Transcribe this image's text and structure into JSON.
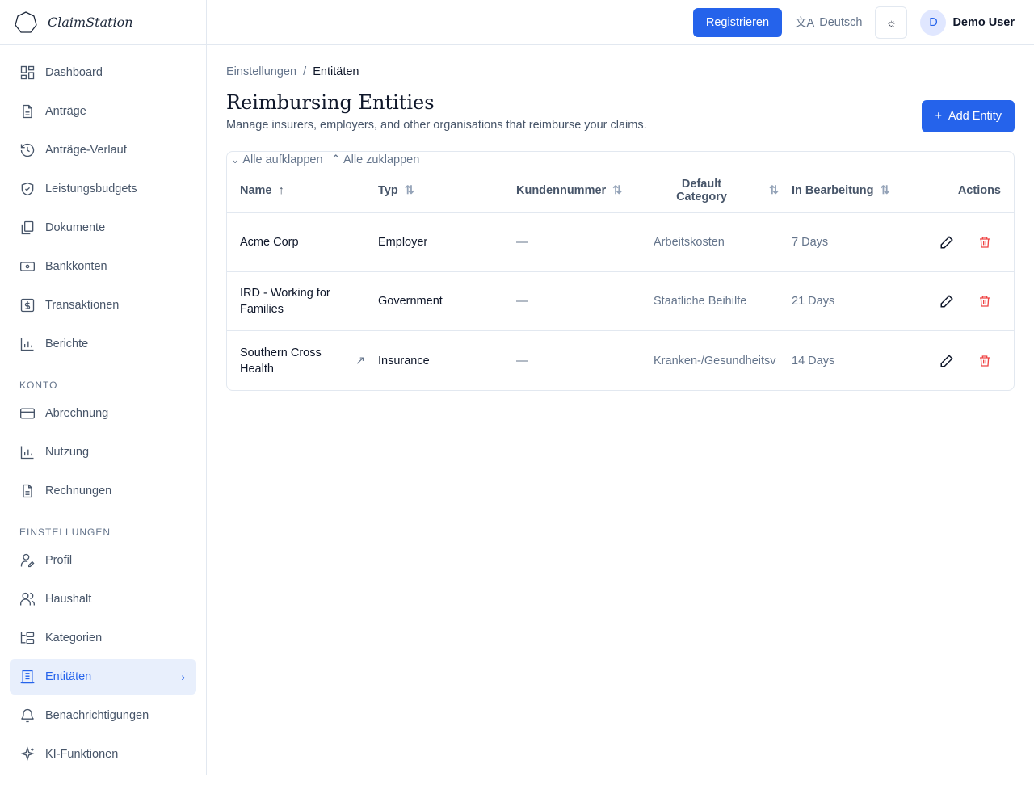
{
  "app": {
    "name": "ClaimStation"
  },
  "sidebar": {
    "items": [
      {
        "label": "Dashboard"
      },
      {
        "label": "Anträge"
      },
      {
        "label": "Anträge-Verlauf"
      },
      {
        "label": "Leistungsbudgets"
      },
      {
        "label": "Dokumente"
      },
      {
        "label": "Bankkonten"
      },
      {
        "label": "Transaktionen"
      },
      {
        "label": "Berichte"
      }
    ],
    "konto_title": "KONTO",
    "konto": [
      {
        "label": "Abrechnung"
      },
      {
        "label": "Nutzung"
      },
      {
        "label": "Rechnungen"
      }
    ],
    "settings_title": "EINSTELLUNGEN",
    "settings": [
      {
        "label": "Profil"
      },
      {
        "label": "Haushalt"
      },
      {
        "label": "Kategorien"
      },
      {
        "label": "Entitäten"
      },
      {
        "label": "Benachrichtigungen"
      },
      {
        "label": "KI-Funktionen"
      }
    ]
  },
  "topbar": {
    "register": "Registrieren",
    "language": "Deutsch",
    "user_initial": "D",
    "user_name": "Demo User"
  },
  "breadcrumb": {
    "parent": "Einstellungen",
    "sep": "/",
    "current": "Entitäten"
  },
  "page": {
    "title": "Reimbursing Entities",
    "subtitle": "Manage insurers, employers, and other organisations that reimburse your claims.",
    "add_button": "Add Entity"
  },
  "table": {
    "expand_all": "Alle aufklappen",
    "collapse_all": "Alle zuklappen",
    "columns": [
      "Name",
      "Typ",
      "Kundennummer",
      "Default Category",
      "In Bearbeitung",
      "Actions"
    ],
    "rows": [
      {
        "name": "Acme Corp",
        "type": "Employer",
        "customer_no": "—",
        "category": "Arbeitskosten",
        "processing": "7 Days",
        "link": false
      },
      {
        "name": "IRD - Working for Families",
        "type": "Government",
        "customer_no": "—",
        "category": "Staatliche Beihilfe",
        "processing": "21 Days",
        "link": false
      },
      {
        "name": "Southern Cross Health",
        "type": "Insurance",
        "customer_no": "—",
        "category": "Kranken-/Gesundheitsv",
        "processing": "14 Days",
        "link": true
      }
    ]
  },
  "colors": {
    "accent": "#2563eb",
    "danger": "#ef4444"
  }
}
